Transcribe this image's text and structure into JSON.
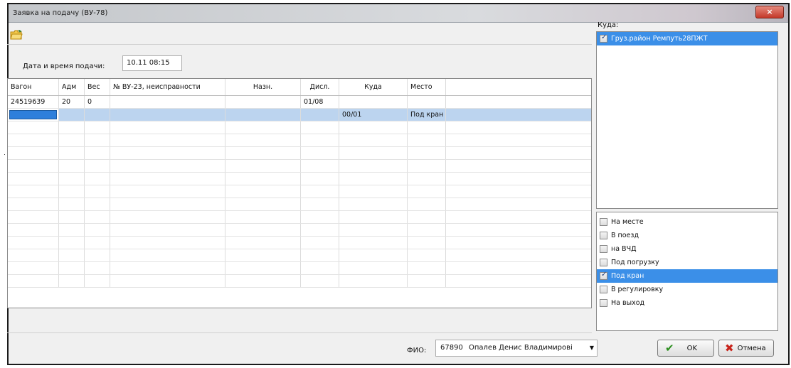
{
  "window": {
    "title": "Заявка на подачу (ВУ-78)",
    "close_glyph": "×"
  },
  "toolbar": {
    "open_icon": "folder-open-icon"
  },
  "date": {
    "label": "Дата и время подачи:",
    "value": "10.11 08:15"
  },
  "grid": {
    "columns": [
      "Вагон",
      "Адм",
      "Вес",
      "№ ВУ-23, неисправности",
      "Назн.",
      "Дисл.",
      "Куда",
      "Место",
      ""
    ],
    "rows": [
      [
        "24519639",
        "20",
        "0",
        "",
        "",
        "01/08",
        "",
        "",
        ""
      ],
      [
        "",
        "",
        "",
        "",
        "",
        "",
        "00/01",
        "Под кран",
        ""
      ]
    ],
    "selected_row": 1,
    "empty_rows": 13
  },
  "kuda": {
    "label": "Куда:",
    "items": [
      {
        "label": "Груз.район Ремпуть28ПЖТ",
        "checked": true,
        "selected": true
      }
    ]
  },
  "destinations": {
    "items": [
      {
        "label": "На месте",
        "checked": false,
        "selected": false
      },
      {
        "label": "В поезд",
        "checked": false,
        "selected": false
      },
      {
        "label": "на ВЧД",
        "checked": false,
        "selected": false
      },
      {
        "label": "Под погрузку",
        "checked": false,
        "selected": false
      },
      {
        "label": "Под кран",
        "checked": true,
        "selected": true
      },
      {
        "label": "В регулировку",
        "checked": false,
        "selected": false
      },
      {
        "label": "На выход",
        "checked": false,
        "selected": false
      }
    ]
  },
  "fio": {
    "label": "ФИО:",
    "code": "67890",
    "name": "Опалев Денис Владимирові"
  },
  "buttons": {
    "ok": "OK",
    "cancel": "Отмена"
  },
  "colors": {
    "selection": "#3b8fe8",
    "row_selection": "#bcd4ef",
    "ok_icon": "#2c8f1f",
    "cancel_icon": "#c8231a"
  }
}
